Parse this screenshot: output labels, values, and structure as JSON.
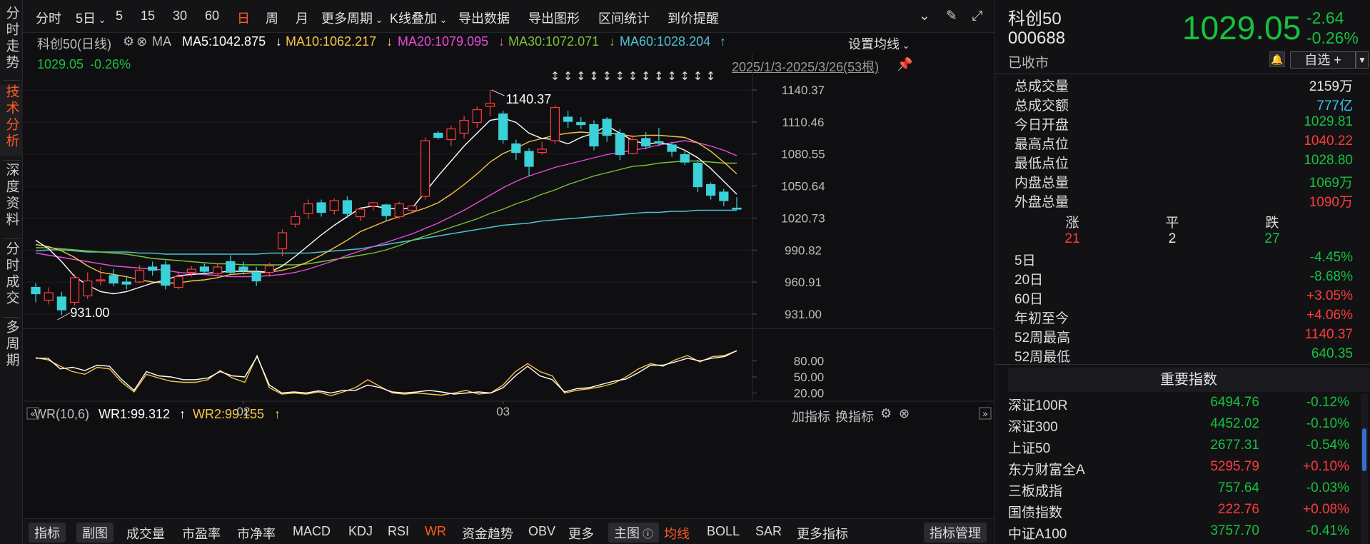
{
  "left_tabs": [
    "分时走势",
    "技术分析",
    "深度资料",
    "分时成交",
    "多周期"
  ],
  "left_tabs_active": 1,
  "toolbar": {
    "items": [
      "分时",
      "5日",
      "5",
      "15",
      "30",
      "60",
      "日",
      "周",
      "月",
      "更多周期",
      "K线叠加",
      "导出数据",
      "导出图形",
      "区间统计",
      "到价提醒"
    ],
    "active": "日"
  },
  "chart_header": {
    "name": "科创50(日线)",
    "ma_label": "MA",
    "ma5": "MA5:1042.875",
    "ma10": "MA10:1062.217",
    "ma20": "MA20:1079.095",
    "ma30": "MA30:1072.071",
    "ma60": "MA60:1028.204",
    "set_ma": "设置均线",
    "last": "1029.05",
    "last_pct": "-0.26%",
    "range": "2025/1/3-2025/3/26(53根)"
  },
  "colors": {
    "up": "#ff3b3b",
    "down": "#3ad1d9",
    "ma5": "#ffffff",
    "ma10": "#f5c542",
    "ma20": "#e84ad8",
    "ma30": "#7cc232",
    "ma60": "#4ec3d2",
    "accent": "#ff5a1f"
  },
  "chart_data": {
    "type": "candlestick",
    "y_ticks": [
      "1140.37",
      "1110.46",
      "1080.55",
      "1050.64",
      "1020.73",
      "990.82",
      "960.91",
      "931.00"
    ],
    "ylim": [
      931.0,
      1140.37
    ],
    "x_ticks": [
      "02",
      "03"
    ],
    "annotations": {
      "high": "1140.37",
      "low": "931.00"
    },
    "candles": [
      [
        956,
        950,
        942,
        960
      ],
      [
        944,
        951,
        940,
        956
      ],
      [
        947,
        935,
        930,
        952
      ],
      [
        942,
        965,
        939,
        968
      ],
      [
        948,
        962,
        945,
        970
      ],
      [
        962,
        963,
        958,
        975
      ],
      [
        967,
        960,
        957,
        973
      ],
      [
        961,
        959,
        954,
        966
      ],
      [
        961,
        972,
        960,
        977
      ],
      [
        975,
        972,
        967,
        980
      ],
      [
        977,
        958,
        954,
        981
      ],
      [
        956,
        966,
        954,
        970
      ],
      [
        970,
        973,
        966,
        976
      ],
      [
        975,
        971,
        968,
        978
      ],
      [
        969,
        975,
        966,
        979
      ],
      [
        980,
        970,
        968,
        986
      ],
      [
        975,
        972,
        968,
        980
      ],
      [
        970,
        962,
        957,
        975
      ],
      [
        970,
        976,
        966,
        979
      ],
      [
        992,
        1007,
        985,
        1010
      ],
      [
        1015,
        1022,
        1012,
        1027
      ],
      [
        1025,
        1034,
        1020,
        1038
      ],
      [
        1035,
        1026,
        1022,
        1038
      ],
      [
        1028,
        1037,
        1024,
        1039
      ],
      [
        1037,
        1025,
        1021,
        1041
      ],
      [
        1022,
        1029,
        1018,
        1031
      ],
      [
        1032,
        1035,
        1028,
        1036
      ],
      [
        1033,
        1023,
        1018,
        1034
      ],
      [
        1022,
        1034,
        1020,
        1036
      ],
      [
        1028,
        1032,
        1026,
        1033
      ],
      [
        1041,
        1093,
        1038,
        1096
      ],
      [
        1100,
        1096,
        1094,
        1102
      ],
      [
        1094,
        1104,
        1088,
        1107
      ],
      [
        1100,
        1112,
        1095,
        1116
      ],
      [
        1110,
        1122,
        1105,
        1125
      ],
      [
        1125,
        1128,
        1116,
        1140.37
      ],
      [
        1118,
        1094,
        1090,
        1121
      ],
      [
        1090,
        1082,
        1075,
        1094
      ],
      [
        1083,
        1069,
        1060,
        1086
      ],
      [
        1082,
        1085,
        1080,
        1092
      ],
      [
        1093,
        1124,
        1090,
        1126
      ],
      [
        1115,
        1111,
        1105,
        1121
      ],
      [
        1110,
        1108,
        1104,
        1115
      ],
      [
        1108,
        1088,
        1084,
        1112
      ],
      [
        1113,
        1098,
        1092,
        1115
      ],
      [
        1100,
        1080,
        1075,
        1104
      ],
      [
        1081,
        1094,
        1080,
        1098
      ],
      [
        1095,
        1088,
        1085,
        1101
      ],
      [
        1092,
        1091,
        1088,
        1105
      ],
      [
        1089,
        1083,
        1078,
        1092
      ],
      [
        1080,
        1073,
        1070,
        1083
      ],
      [
        1072,
        1050,
        1045,
        1075
      ],
      [
        1052,
        1042,
        1038,
        1054
      ],
      [
        1045,
        1037,
        1032,
        1048
      ],
      [
        1030,
        1029.05,
        1028.8,
        1040.22
      ]
    ],
    "ma5": [
      1000,
      992,
      980,
      966,
      958,
      952,
      950,
      952,
      956,
      960,
      963,
      967,
      968,
      969,
      970,
      971,
      971,
      971,
      970,
      976,
      985,
      995,
      1005,
      1014,
      1022,
      1030,
      1032,
      1030,
      1029,
      1030,
      1045,
      1060,
      1074,
      1088,
      1100,
      1112,
      1114,
      1110,
      1100,
      1095,
      1094,
      1090,
      1096,
      1100,
      1107,
      1100,
      1093,
      1090,
      1091,
      1089,
      1084,
      1077,
      1067,
      1055,
      1043
    ],
    "ma10": [
      996,
      994,
      990,
      984,
      976,
      970,
      968,
      966,
      963,
      961,
      960,
      960,
      962,
      963,
      965,
      968,
      969,
      970,
      970,
      972,
      975,
      980,
      986,
      993,
      1000,
      1008,
      1013,
      1018,
      1022,
      1026,
      1030,
      1035,
      1043,
      1052,
      1062,
      1073,
      1081,
      1086,
      1092,
      1095,
      1098,
      1100,
      1101,
      1100,
      1100,
      1099,
      1097,
      1098,
      1098,
      1097,
      1096,
      1091,
      1083,
      1073,
      1062
    ],
    "ma20": [
      988,
      986,
      984,
      982,
      980,
      978,
      976,
      975,
      974,
      973,
      972,
      970,
      969,
      968,
      967,
      966,
      966,
      966,
      967,
      968,
      970,
      973,
      977,
      981,
      986,
      990,
      994,
      998,
      1002,
      1006,
      1011,
      1016,
      1022,
      1028,
      1035,
      1042,
      1049,
      1055,
      1060,
      1064,
      1068,
      1071,
      1074,
      1077,
      1080,
      1082,
      1084,
      1086,
      1089,
      1091,
      1093,
      1091,
      1088,
      1084,
      1079
    ],
    "ma30": [
      993,
      993,
      992,
      991,
      990,
      989,
      988,
      987,
      985,
      983,
      982,
      981,
      980,
      979,
      978,
      978,
      977,
      977,
      977,
      977,
      977,
      978,
      980,
      982,
      984,
      986,
      988,
      991,
      995,
      1000,
      1004,
      1008,
      1012,
      1016,
      1020,
      1025,
      1029,
      1034,
      1038,
      1043,
      1047,
      1052,
      1056,
      1060,
      1063,
      1066,
      1069,
      1070,
      1072,
      1073,
      1074,
      1074,
      1073,
      1072,
      1072
    ],
    "ma60": [
      990,
      991,
      991,
      990,
      989,
      989,
      989,
      989,
      988,
      988,
      987,
      987,
      987,
      987,
      987,
      987,
      987,
      987,
      988,
      988,
      988,
      988,
      989,
      990,
      991,
      992,
      994,
      996,
      998,
      1000,
      1002,
      1004,
      1006,
      1008,
      1010,
      1012,
      1014,
      1015,
      1016,
      1018,
      1019,
      1020,
      1021,
      1022,
      1023,
      1024,
      1025,
      1026,
      1026,
      1027,
      1027,
      1028,
      1028,
      1028,
      1028
    ]
  },
  "sub_chart": {
    "name": "WR(10,6)",
    "wr1": "WR1:99.312",
    "wr2": "WR2:99.155",
    "add_indicator": "加指标",
    "switch_indicator": "换指标",
    "y_ticks": [
      "80.00",
      "50.00",
      "20.00"
    ],
    "wr1_values": [
      85,
      85,
      65,
      68,
      62,
      72,
      70,
      45,
      25,
      60,
      52,
      50,
      45,
      45,
      48,
      60,
      52,
      50,
      88,
      35,
      20,
      22,
      20,
      24,
      20,
      25,
      25,
      35,
      30,
      22,
      20,
      22,
      25,
      22,
      18,
      20,
      22,
      20,
      30,
      52,
      70,
      52,
      45,
      22,
      28,
      30,
      36,
      42,
      46,
      58,
      72,
      72,
      78,
      85,
      80,
      85,
      88,
      99
    ],
    "wr2_values": [
      86,
      82,
      70,
      60,
      55,
      68,
      65,
      40,
      22,
      55,
      48,
      42,
      40,
      40,
      45,
      62,
      48,
      40,
      90,
      30,
      18,
      20,
      18,
      22,
      15,
      22,
      30,
      45,
      32,
      20,
      18,
      20,
      18,
      16,
      20,
      25,
      18,
      20,
      35,
      60,
      75,
      60,
      52,
      20,
      25,
      28,
      32,
      38,
      50,
      65,
      75,
      70,
      82,
      90,
      78,
      88,
      90,
      99
    ]
  },
  "bottombar": {
    "items": [
      "指标",
      "副图",
      "成交量",
      "市盈率",
      "市净率",
      "MACD",
      "KDJ",
      "RSI",
      "WR",
      "资金趋势",
      "OBV",
      "更多",
      "主图",
      "均线",
      "BOLL",
      "SAR",
      "更多指标",
      "指标管理"
    ]
  },
  "quote": {
    "name": "科创50",
    "code": "000688",
    "status": "已收市",
    "price": "1029.05",
    "change": "-2.64",
    "change_pct": "-0.26%",
    "watchlist": "自选 +"
  },
  "stats": [
    {
      "k": "总成交量",
      "v": "2159万",
      "c": "white"
    },
    {
      "k": "总成交额",
      "v": "777亿",
      "c": "cyan"
    },
    {
      "k": "今日开盘",
      "v": "1029.81",
      "c": "green"
    },
    {
      "k": "最高点位",
      "v": "1040.22",
      "c": "red"
    },
    {
      "k": "最低点位",
      "v": "1028.80",
      "c": "green"
    },
    {
      "k": "内盘总量",
      "v": "1069万",
      "c": "green"
    },
    {
      "k": "外盘总量",
      "v": "1090万",
      "c": "red"
    }
  ],
  "breadth": {
    "labels": [
      "涨",
      "平",
      "跌"
    ],
    "values": [
      "21",
      "2",
      "27"
    ]
  },
  "periods": [
    {
      "k": "5日",
      "v": "-4.45%",
      "c": "green"
    },
    {
      "k": "20日",
      "v": "-8.68%",
      "c": "green"
    },
    {
      "k": "60日",
      "v": "+3.05%",
      "c": "red"
    },
    {
      "k": "年初至今",
      "v": "+4.06%",
      "c": "red"
    },
    {
      "k": "52周最高",
      "v": "1140.37",
      "c": "red"
    },
    {
      "k": "52周最低",
      "v": "640.35",
      "c": "green"
    }
  ],
  "index_title": "重要指数",
  "indices": [
    {
      "n": "深证100R",
      "p": "6494.76",
      "c": "-0.12%",
      "col": "green"
    },
    {
      "n": "深证300",
      "p": "4452.02",
      "c": "-0.10%",
      "col": "green"
    },
    {
      "n": "上证50",
      "p": "2677.31",
      "c": "-0.54%",
      "col": "green"
    },
    {
      "n": "东方财富全A",
      "p": "5295.79",
      "c": "+0.10%",
      "col": "red"
    },
    {
      "n": "三板成指",
      "p": "757.64",
      "c": "-0.03%",
      "col": "green"
    },
    {
      "n": "国债指数",
      "p": "222.76",
      "c": "+0.08%",
      "col": "red"
    },
    {
      "n": "中证A100",
      "p": "3757.70",
      "c": "-0.41%",
      "col": "green"
    }
  ]
}
